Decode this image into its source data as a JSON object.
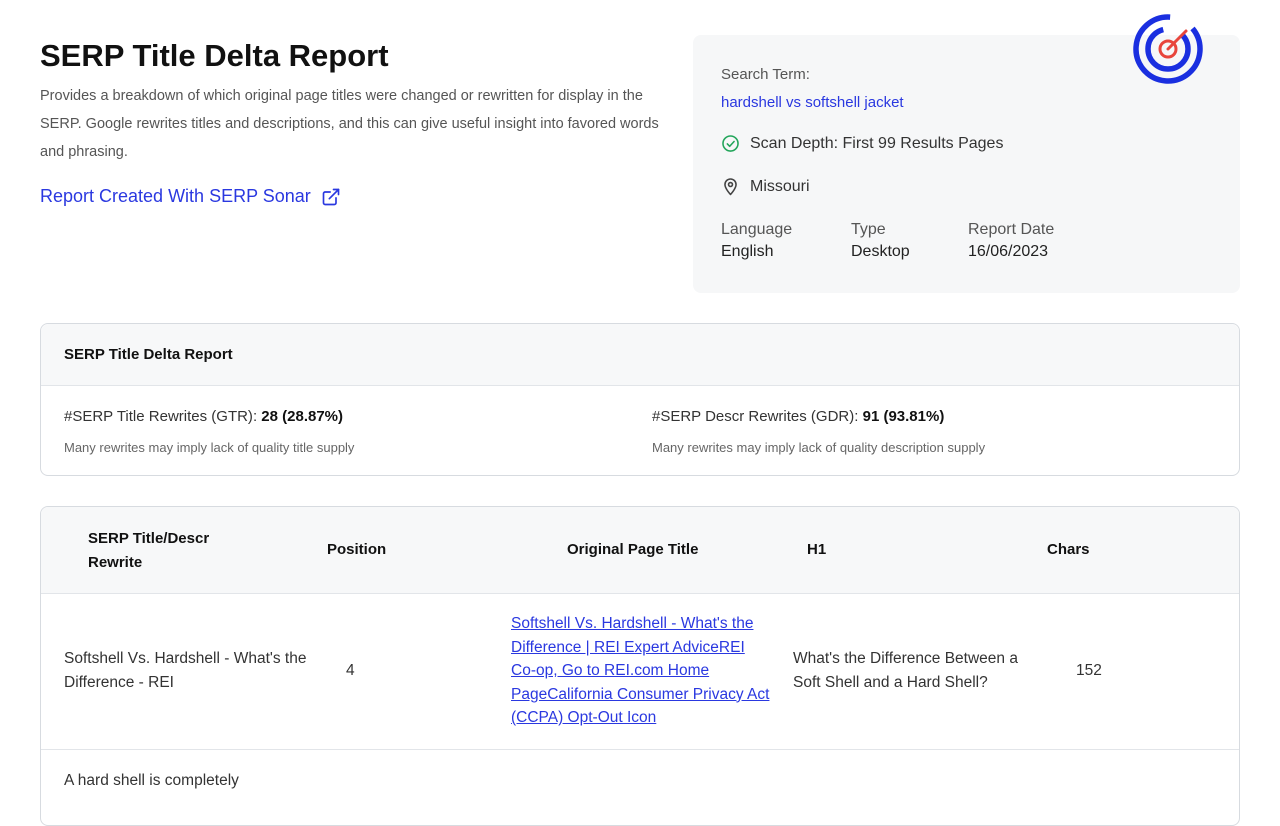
{
  "header": {
    "title": "SERP Title Delta Report",
    "description": "Provides a breakdown of which original page titles were changed or rewritten for display in the SERP. Google rewrites titles and descriptions, and this can give useful insight into favored words and phrasing.",
    "report_link": "Report Created With SERP Sonar",
    "link_icon": "external-link-icon"
  },
  "info": {
    "search_term_label": "Search Term:",
    "search_term": "hardshell vs softshell jacket",
    "scan_depth": "Scan Depth: First 99 Results Pages",
    "scan_icon": "check-circle-icon",
    "location": "Missouri",
    "location_icon": "map-pin-icon",
    "language_label": "Language",
    "language": "English",
    "type_label": "Type",
    "type": "Desktop",
    "date_label": "Report Date",
    "date": "16/06/2023"
  },
  "logo": {
    "icon": "target-logo-icon",
    "colors": [
      "#1a2fe0",
      "#e8453c"
    ]
  },
  "summary": {
    "title": "SERP Title Delta Report",
    "gtr_label": "#SERP Title Rewrites (GTR)",
    "gtr_value": "28 (28.87%)",
    "gtr_note": "Many rewrites may imply lack of quality title supply",
    "gdr_label": "#SERP Descr Rewrites (GDR)",
    "gdr_value": "91 (93.81%)",
    "gdr_note": "Many rewrites may imply lack of quality description supply"
  },
  "table": {
    "columns": [
      "SERP Title/Descr Rewrite",
      "Position",
      "Original Page Title",
      "H1",
      "Chars"
    ],
    "rows": [
      {
        "rewrite": "Softshell Vs. Hardshell - What's the Difference - REI",
        "position": "4",
        "original_title": "Softshell Vs. Hardshell - What's the Difference | REI Expert AdviceREI Co-op, Go to REI.com Home PageCalifornia Consumer Privacy Act (CCPA) Opt-Out Icon",
        "h1": "What's the Difference Between a Soft Shell and a Hard Shell?",
        "chars": "152"
      },
      {
        "rewrite": "A hard shell is completely",
        "position": "",
        "original_title": "",
        "h1": "",
        "chars": ""
      }
    ]
  },
  "colors": {
    "accent": "#2a38e0",
    "card_bg": "#f6f7f8",
    "success": "#22a55a"
  }
}
